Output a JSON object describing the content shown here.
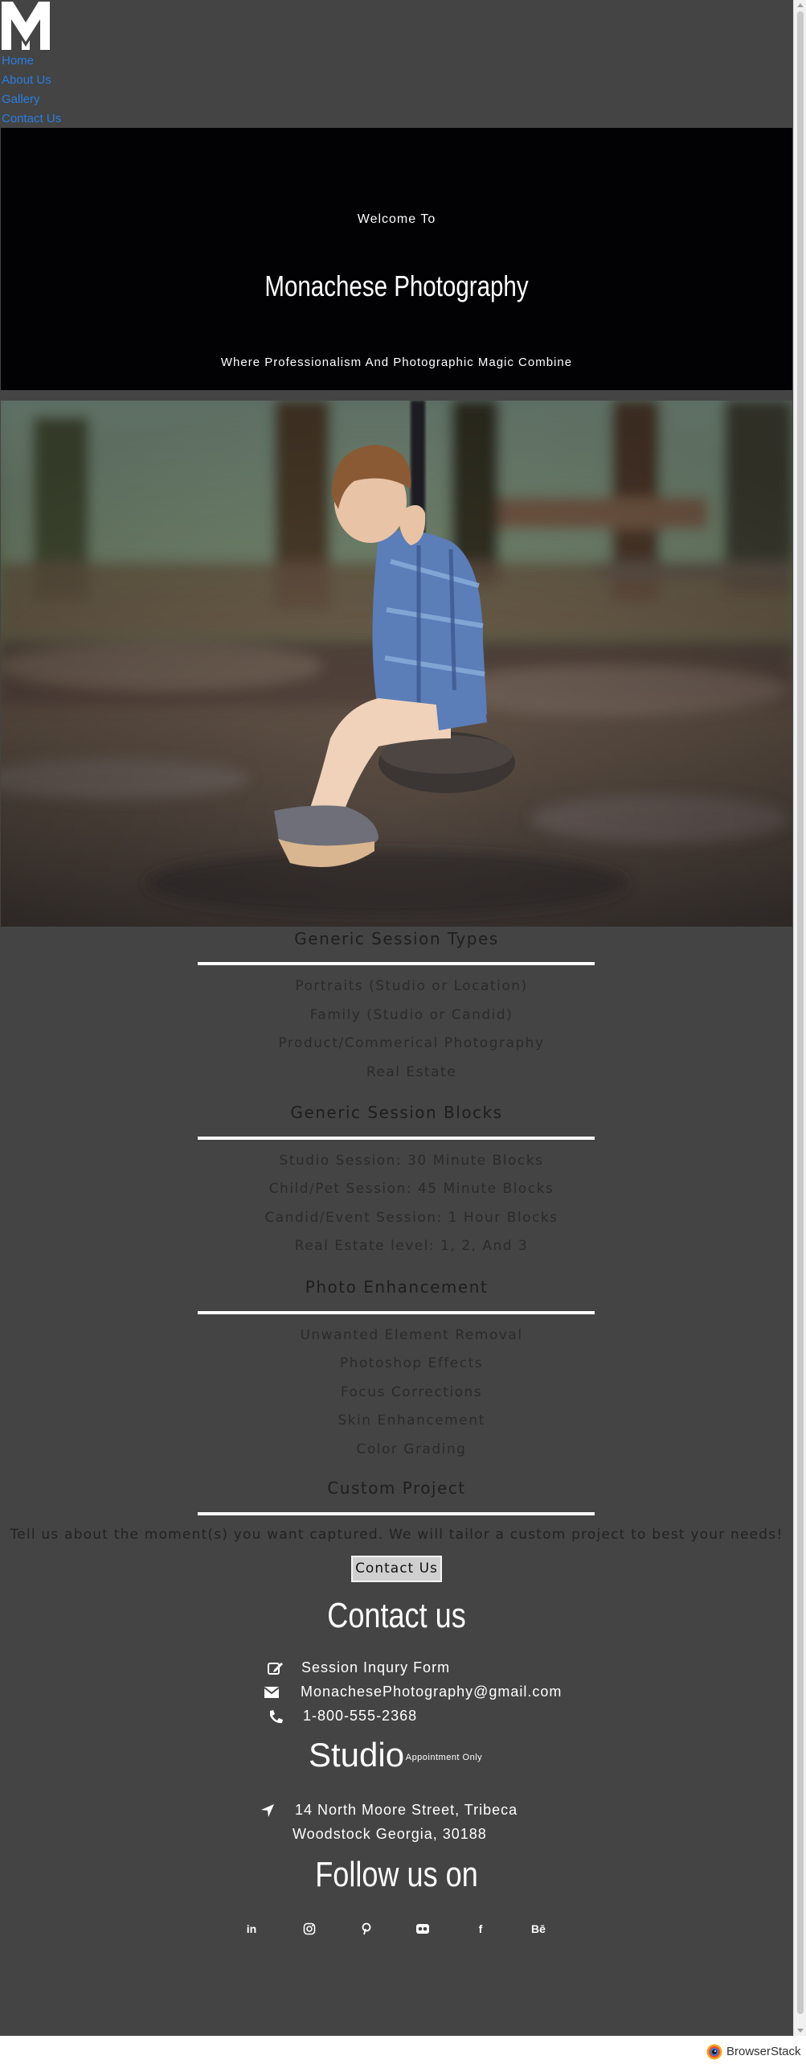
{
  "nav": {
    "logo_letter": "M",
    "items": [
      "Home",
      "About Us",
      "Gallery",
      "Contact Us"
    ]
  },
  "hero": {
    "welcome": "Welcome To",
    "title": "Monachese Photography",
    "tagline": "Where Professionalism And Photographic Magic Combine"
  },
  "sections": [
    {
      "title": "Generic Session Types",
      "items": [
        "Portraits (Studio or Location)",
        "Family (Studio or Candid)",
        "Product/Commerical Photography",
        "Real Estate"
      ]
    },
    {
      "title": "Generic Session Blocks",
      "items": [
        "Studio Session: 30 Minute Blocks",
        "Child/Pet Session: 45 Minute Blocks",
        "Candid/Event Session: 1 Hour Blocks",
        "Real Estate level: 1, 2, And 3"
      ]
    },
    {
      "title": "Photo Enhancement",
      "items": [
        "Unwanted Element Removal",
        "Photoshop Effects",
        "Focus Corrections",
        "Skin Enhancement",
        "Color Grading"
      ]
    }
  ],
  "custom": {
    "title": "Custom Project",
    "text": "Tell us about the moment(s) you want captured. We will tailor a custom project to best your needs!",
    "button": "Contact Us"
  },
  "contact": {
    "heading": "Contact us",
    "rows": [
      {
        "icon": "edit-icon",
        "text": "Session Inqury Form"
      },
      {
        "icon": "envelope-icon",
        "text": "MonachesePhotography@gmail.com"
      },
      {
        "icon": "phone-icon",
        "text": "1-800-555-2368"
      }
    ]
  },
  "studio": {
    "heading": "Studio",
    "note": "* Appointment Only",
    "address_line1": "14 North Moore Street, Tribeca",
    "address_line2": "Woodstock Georgia, 30188",
    "icon": "location-arrow-icon"
  },
  "follow": {
    "heading": "Follow us on",
    "icons": [
      {
        "name": "linkedin-icon",
        "glyph": "in"
      },
      {
        "name": "instagram-icon",
        "glyph": ""
      },
      {
        "name": "pinterest-icon",
        "glyph": ""
      },
      {
        "name": "flickr-icon",
        "glyph": ""
      },
      {
        "name": "facebook-icon",
        "glyph": "f"
      },
      {
        "name": "behance-icon",
        "glyph": "Bē"
      }
    ]
  },
  "footer": {
    "brand": "BrowserStack"
  },
  "colors": {
    "page_bg": "#444444",
    "hero_bg": "#020205",
    "link": "#2a7de1",
    "divider": "#ffffff"
  }
}
